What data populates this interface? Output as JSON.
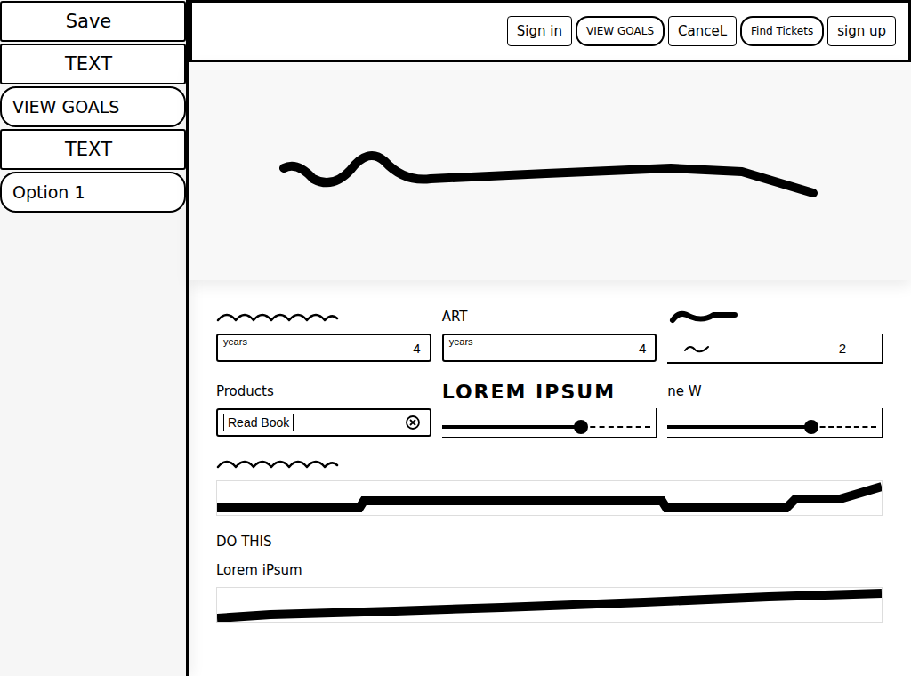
{
  "sidebar": {
    "items": [
      {
        "label": "Save",
        "kind": "box",
        "selected": false
      },
      {
        "label": "TEXT",
        "kind": "box",
        "selected": false
      },
      {
        "label": "VIEW GOALS",
        "kind": "pill",
        "selected": false
      },
      {
        "label": "TEXT",
        "kind": "box",
        "selected": false
      },
      {
        "label": "Option 1",
        "kind": "pill",
        "selected": false
      }
    ]
  },
  "header": {
    "buttons": [
      {
        "label": "Sign in",
        "kind": "box"
      },
      {
        "label": "VIEW GOALS",
        "kind": "pill"
      },
      {
        "label": "CanceL",
        "kind": "box"
      },
      {
        "label": "Find Tickets",
        "kind": "pill"
      },
      {
        "label": "sign up",
        "kind": "box"
      }
    ]
  },
  "fields": [
    {
      "kind": "input",
      "label": null,
      "hint": "years",
      "value": "4"
    },
    {
      "kind": "input",
      "label": "ART",
      "hint": "years",
      "value": "4"
    },
    {
      "kind": "sketch",
      "label": null,
      "value": "2"
    },
    {
      "kind": "search",
      "label": "Products",
      "value": "Read Book"
    },
    {
      "kind": "slider",
      "label": "LOREM IPSUM",
      "level": 0.65
    },
    {
      "kind": "slider",
      "label": "ne W",
      "level": 0.67
    }
  ],
  "wide_bars": [
    {
      "labels": [
        null
      ]
    },
    {
      "labels": [
        "DO THIS",
        "Lorem iPsum"
      ]
    }
  ]
}
